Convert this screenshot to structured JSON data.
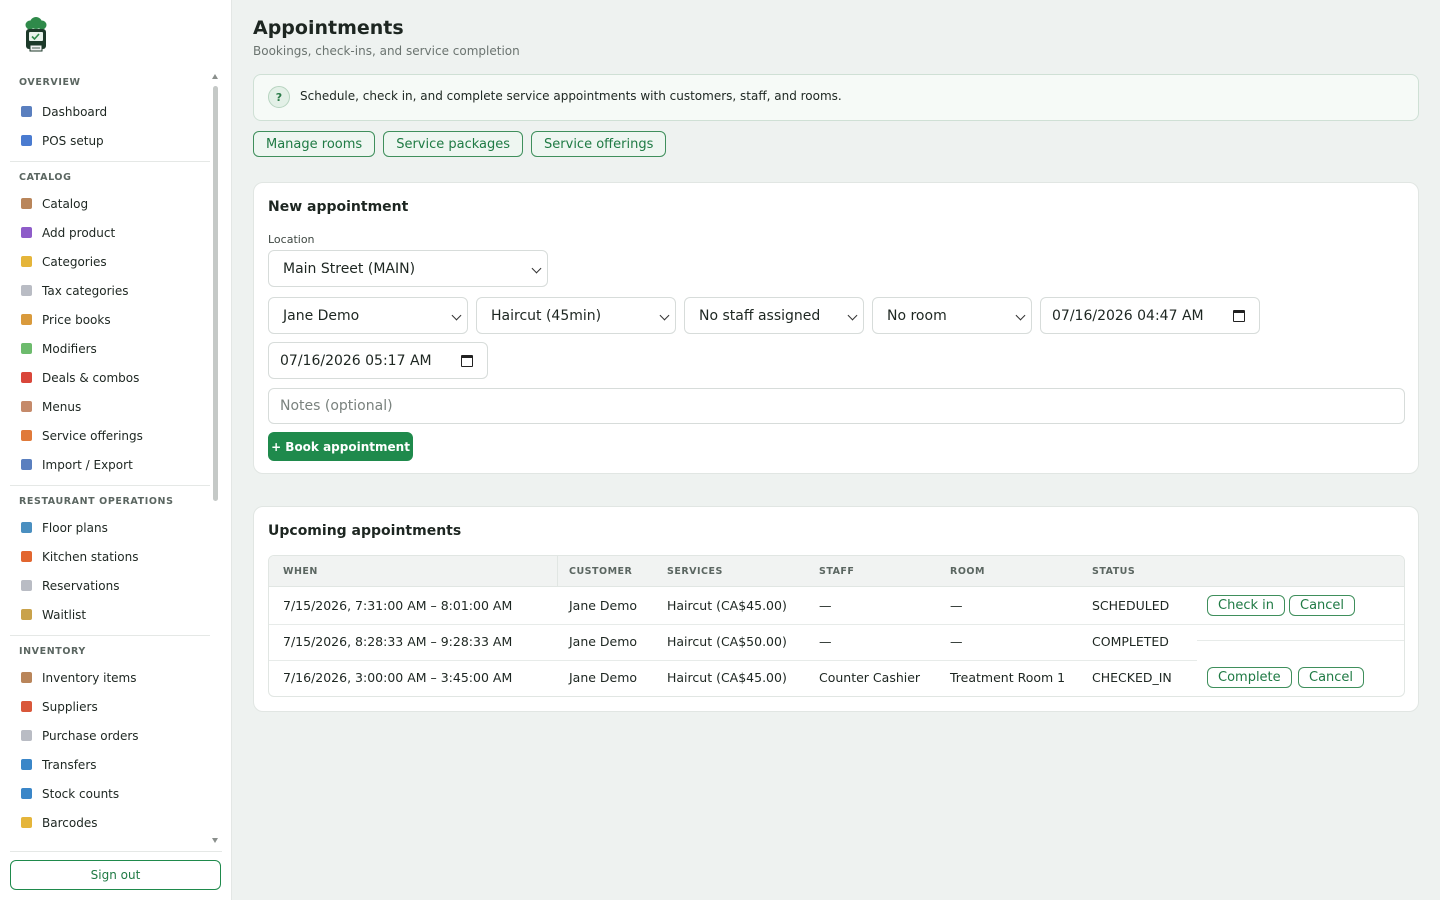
{
  "sidebar": {
    "sections": [
      {
        "title": "OVERVIEW",
        "items": [
          {
            "label": "Dashboard",
            "icon": "bar-chart-icon",
            "color": "#5a7fbf"
          },
          {
            "label": "POS setup",
            "icon": "monitor-icon",
            "color": "#4a7bd0"
          }
        ]
      },
      {
        "title": "CATALOG",
        "items": [
          {
            "label": "Catalog",
            "icon": "box-icon",
            "color": "#b9855a"
          },
          {
            "label": "Add product",
            "icon": "plus-icon",
            "color": "#8e5cc9"
          },
          {
            "label": "Categories",
            "icon": "folder-icon",
            "color": "#e5b53a"
          },
          {
            "label": "Tax categories",
            "icon": "receipt-icon",
            "color": "#b9bcc4"
          },
          {
            "label": "Price books",
            "icon": "money-bag-icon",
            "color": "#d99a3c"
          },
          {
            "label": "Modifiers",
            "icon": "puzzle-icon",
            "color": "#6dbb6d"
          },
          {
            "label": "Deals & combos",
            "icon": "gift-icon",
            "color": "#d9463a"
          },
          {
            "label": "Menus",
            "icon": "clipboard-icon",
            "color": "#c58a6a"
          },
          {
            "label": "Service offerings",
            "icon": "person-icon",
            "color": "#e07a3a"
          },
          {
            "label": "Import / Export",
            "icon": "inbox-icon",
            "color": "#5a7fbf"
          }
        ]
      },
      {
        "title": "RESTAURANT OPERATIONS",
        "items": [
          {
            "label": "Floor plans",
            "icon": "map-icon",
            "color": "#4a8fc0"
          },
          {
            "label": "Kitchen stations",
            "icon": "fire-icon",
            "color": "#e2662f"
          },
          {
            "label": "Reservations",
            "icon": "calendar-icon",
            "color": "#b9bcc4"
          },
          {
            "label": "Waitlist",
            "icon": "hourglass-icon",
            "color": "#c9a24a"
          }
        ]
      },
      {
        "title": "INVENTORY",
        "items": [
          {
            "label": "Inventory items",
            "icon": "box-icon",
            "color": "#b9855a"
          },
          {
            "label": "Suppliers",
            "icon": "truck-icon",
            "color": "#d9573a"
          },
          {
            "label": "Purchase orders",
            "icon": "receipt-icon",
            "color": "#b9bcc4"
          },
          {
            "label": "Transfers",
            "icon": "transfer-icon",
            "color": "#3a86c8"
          },
          {
            "label": "Stock counts",
            "icon": "numbers-icon",
            "color": "#3a86c8"
          },
          {
            "label": "Barcodes",
            "icon": "tag-icon",
            "color": "#e5b53a"
          }
        ]
      }
    ],
    "sign_out": "Sign out"
  },
  "header": {
    "title": "Appointments",
    "subtitle": "Bookings, check-ins, and service completion"
  },
  "info": {
    "badge": "?",
    "text": "Schedule, check in, and complete service appointments with customers, staff, and rooms."
  },
  "links": [
    "Manage rooms",
    "Service packages",
    "Service offerings"
  ],
  "new_appointment": {
    "title": "New appointment",
    "location_label": "Location",
    "location_value": "Main Street (MAIN)",
    "customer_value": "Jane Demo",
    "service_value": "Haircut (45min)",
    "staff_value": "No staff assigned",
    "room_value": "No room",
    "start_value": "07/16/2026 04:47 AM",
    "end_value": "07/16/2026 05:17 AM",
    "notes_placeholder": "Notes (optional)",
    "book_label": "+ Book appointment"
  },
  "upcoming": {
    "title": "Upcoming appointments",
    "columns": [
      "WHEN",
      "CUSTOMER",
      "SERVICES",
      "STAFF",
      "ROOM",
      "STATUS"
    ],
    "rows": [
      {
        "when": "7/15/2026, 7:31:00 AM – 8:01:00 AM",
        "customer": "Jane Demo",
        "services": "Haircut (CA$45.00)",
        "staff": "—",
        "room": "—",
        "status": "SCHEDULED",
        "actions": [
          "Check in",
          "Cancel"
        ]
      },
      {
        "when": "7/15/2026, 8:28:33 AM – 9:28:33 AM",
        "customer": "Jane Demo",
        "services": "Haircut (CA$50.00)",
        "staff": "—",
        "room": "—",
        "status": "COMPLETED",
        "actions": []
      },
      {
        "when": "7/16/2026, 3:00:00 AM – 3:45:00 AM",
        "customer": "Jane Demo",
        "services": "Haircut (CA$45.00)",
        "staff": "Counter Cashier",
        "room": "Treatment Room 1",
        "status": "CHECKED_IN",
        "actions": [
          "Complete",
          "Cancel"
        ]
      }
    ]
  },
  "colors": {
    "accent": "#1f8a4c",
    "sidebar_bg": "#ffffff",
    "page_bg": "#eef2f0"
  }
}
